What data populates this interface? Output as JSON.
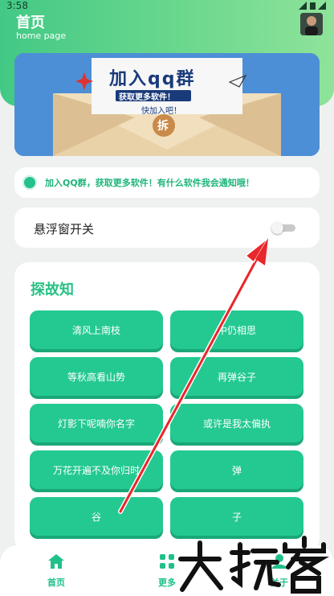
{
  "status_bar": {
    "time": "3:58"
  },
  "header": {
    "title": "首页",
    "subtitle": "home page"
  },
  "banner": {
    "headline": "加入qq群",
    "line1": "获取更多软件！",
    "line2": "快加入吧！",
    "seal": "拆"
  },
  "notice": {
    "text": "加入QQ群，获取更多软件！有什么软件我会通知哦！"
  },
  "float_toggle": {
    "label": "悬浮窗开关",
    "state": "off"
  },
  "panel": {
    "title": "探故知",
    "buttons": [
      "清风上南枝",
      "中仍相思",
      "等秋高看山势",
      "再弹谷子",
      "灯影下呢喃你名字",
      "或许是我太偏执",
      "万花开遍不及你归时",
      "弹",
      "谷",
      "子"
    ]
  },
  "bottom_nav": {
    "items": [
      {
        "label": "首页"
      },
      {
        "label": "更多"
      },
      {
        "label": "关于"
      }
    ]
  },
  "watermark": {
    "text": "大玩客"
  },
  "colors": {
    "accent": "#24c992",
    "header_start": "#42c985",
    "header_end": "#8fe39a"
  }
}
